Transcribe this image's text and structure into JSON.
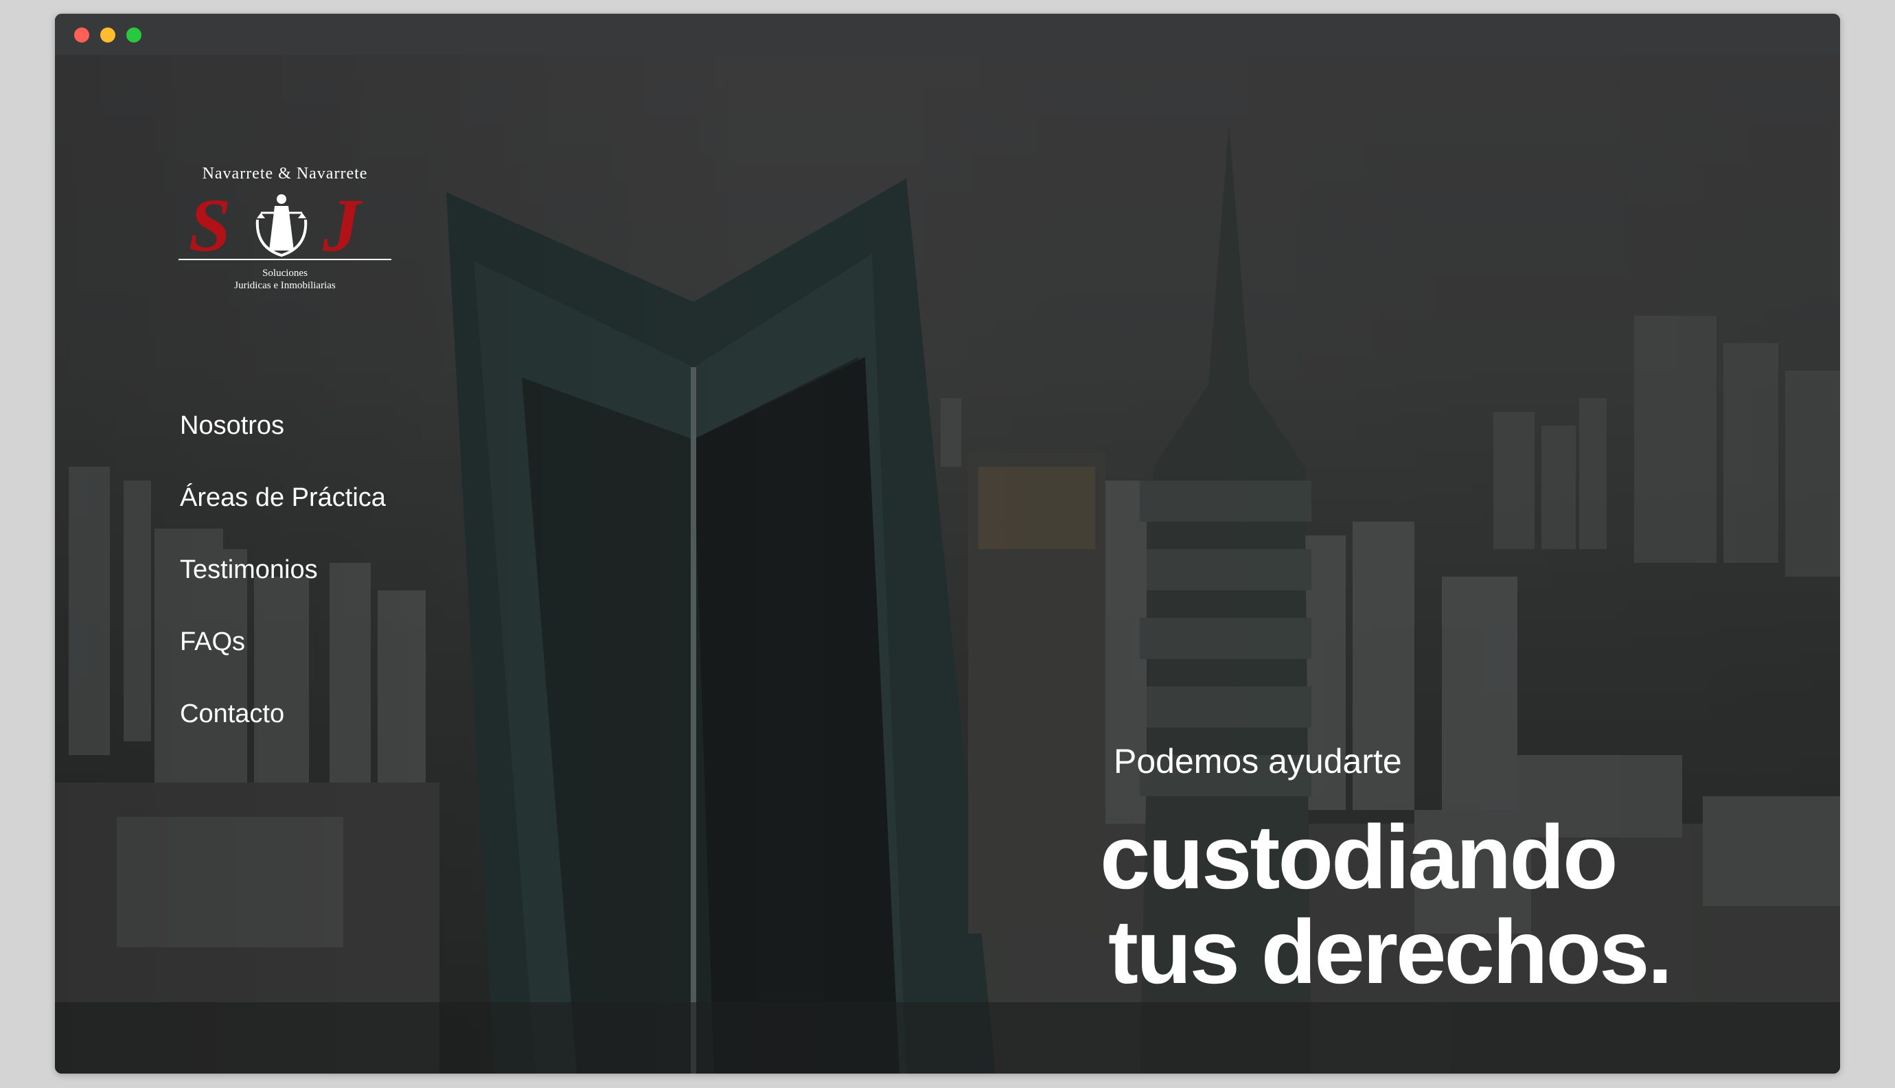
{
  "window": {
    "controls": [
      "close",
      "minimize",
      "maximize"
    ]
  },
  "logo": {
    "top_text": "Navarrete  &  Navarrete",
    "monogram_left": "S",
    "monogram_right": "J",
    "subtitle_line1": "Soluciones",
    "subtitle_line2": "Juridicas e Inmobiliarias",
    "emblem_icon": "lady-justice-icon",
    "accent_color": "#b01217"
  },
  "nav": {
    "items": [
      {
        "label": "Nosotros"
      },
      {
        "label": "Áreas de Práctica"
      },
      {
        "label": "Testimonios"
      },
      {
        "label": "FAQs"
      },
      {
        "label": "Contacto"
      }
    ]
  },
  "hero": {
    "subtitle": "Podemos ayudarte",
    "title_line1": "custodiando",
    "title_line2": "tus derechos."
  },
  "colors": {
    "text": "#ffffff",
    "titlebar": "#38393b",
    "page_frame": "#d4d4d4"
  }
}
